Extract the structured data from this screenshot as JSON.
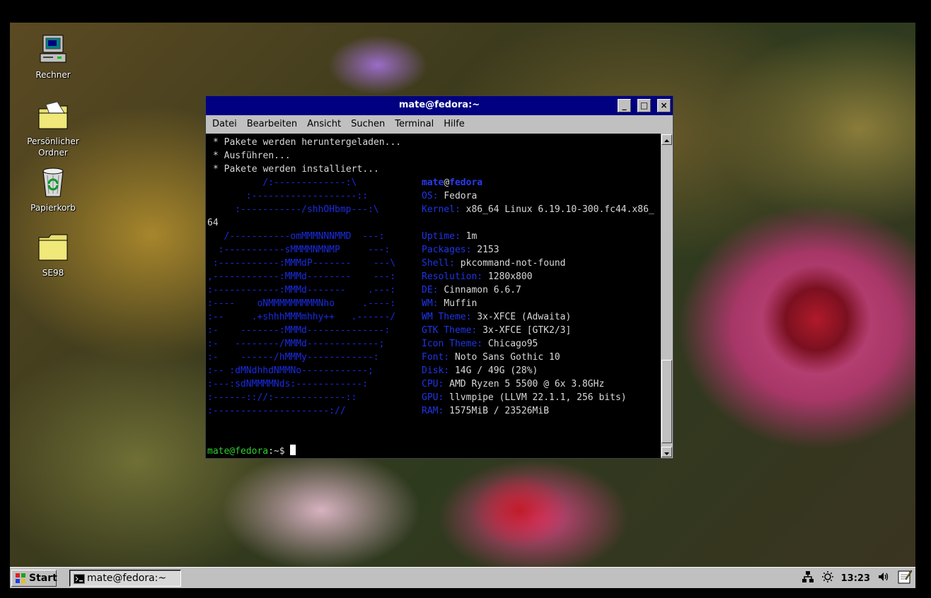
{
  "desktop": {
    "icons": [
      {
        "label": "Rechner",
        "icon": "computer-icon"
      },
      {
        "label": "Persönlicher Ordner",
        "icon": "folder-home-icon"
      },
      {
        "label": "Papierkorb",
        "icon": "trash-icon"
      },
      {
        "label": "SE98",
        "icon": "folder-icon"
      }
    ]
  },
  "window": {
    "title": "mate@fedora:~",
    "buttons": {
      "minimize": "_",
      "maximize": "□",
      "close": "×"
    },
    "menu": [
      "Datei",
      "Bearbeiten",
      "Ansicht",
      "Suchen",
      "Terminal",
      "Hilfe"
    ]
  },
  "terminal": {
    "pre": [
      "* Pakete werden heruntergeladen...",
      "* Ausführen...",
      "* Pakete werden installiert..."
    ],
    "logo": [
      "          /:-------------:\\",
      "       :-------------------::",
      "     :-----------/shhOHbmp---:\\",
      "   /-----------omMMMNNNMMD  ---:",
      "  :-----------sMMMMNMNMP     ---:",
      " :-----------:MMMdP-------    ---\\",
      ",------------:MMMd--------    ---:",
      ":------------:MMMd-------    .---:",
      ":----    oNMMMMMMMMMNho     .----:",
      ":--     .+shhhMMMmhhy++   .------/",
      ":-    -------:MMMd--------------:",
      ":-   --------/MMMd-------------;",
      ":-    ------/hMMMy------------:",
      ":-- :dMNdhhdNMMNo------------;",
      ":---:sdNMMMMNds:------------:",
      ":------:://:-------------::",
      ":---------------------://"
    ],
    "logo_wrap": "64",
    "user": "mate",
    "at": "@",
    "host": "fedora",
    "info": [
      {
        "label": "OS:",
        "value": "Fedora"
      },
      {
        "label": "Kernel:",
        "value": "x86_64 Linux 6.19.10-300.fc44.x86_"
      },
      {
        "label": "Uptime:",
        "value": "1m"
      },
      {
        "label": "Packages:",
        "value": "2153"
      },
      {
        "label": "Shell:",
        "value": "pkcommand-not-found"
      },
      {
        "label": "Resolution:",
        "value": "1280x800"
      },
      {
        "label": "DE:",
        "value": "Cinnamon 6.6.7"
      },
      {
        "label": "WM:",
        "value": "Muffin"
      },
      {
        "label": "WM Theme:",
        "value": "3x-XFCE (Adwaita)"
      },
      {
        "label": "GTK Theme:",
        "value": "3x-XFCE [GTK2/3]"
      },
      {
        "label": "Icon Theme:",
        "value": "Chicago95"
      },
      {
        "label": "Font:",
        "value": "Noto Sans Gothic 10"
      },
      {
        "label": "Disk:",
        "value": "14G / 49G (28%)"
      },
      {
        "label": "CPU:",
        "value": "AMD Ryzen 5 5500 @ 6x 3.8GHz"
      },
      {
        "label": "GPU:",
        "value": "llvmpipe (LLVM 22.1.1, 256 bits)"
      },
      {
        "label": "RAM:",
        "value": "1575MiB / 23526MiB"
      }
    ],
    "prompt_user_host": "mate@fedora",
    "prompt_path": ":~",
    "prompt_symbol": "$ "
  },
  "taskbar": {
    "start_label": "Start",
    "task_label": "mate@fedora:~",
    "clock": "13:23"
  },
  "colors": {
    "titlebar": "#000080",
    "chrome": "#c0c0c0",
    "prompt": "#2fcf2f",
    "neofetch_label": "#1f35e6"
  }
}
